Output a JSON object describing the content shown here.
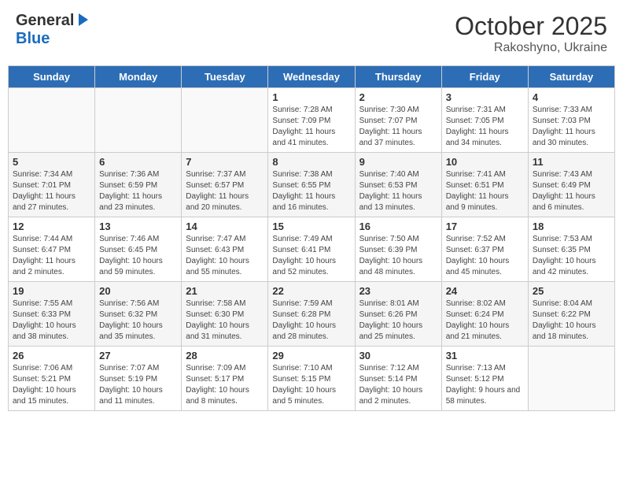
{
  "header": {
    "logo_general": "General",
    "logo_blue": "Blue",
    "month": "October 2025",
    "location": "Rakoshyno, Ukraine"
  },
  "days_of_week": [
    "Sunday",
    "Monday",
    "Tuesday",
    "Wednesday",
    "Thursday",
    "Friday",
    "Saturday"
  ],
  "weeks": [
    [
      {
        "day": "",
        "info": ""
      },
      {
        "day": "",
        "info": ""
      },
      {
        "day": "",
        "info": ""
      },
      {
        "day": "1",
        "info": "Sunrise: 7:28 AM\nSunset: 7:09 PM\nDaylight: 11 hours\nand 41 minutes."
      },
      {
        "day": "2",
        "info": "Sunrise: 7:30 AM\nSunset: 7:07 PM\nDaylight: 11 hours\nand 37 minutes."
      },
      {
        "day": "3",
        "info": "Sunrise: 7:31 AM\nSunset: 7:05 PM\nDaylight: 11 hours\nand 34 minutes."
      },
      {
        "day": "4",
        "info": "Sunrise: 7:33 AM\nSunset: 7:03 PM\nDaylight: 11 hours\nand 30 minutes."
      }
    ],
    [
      {
        "day": "5",
        "info": "Sunrise: 7:34 AM\nSunset: 7:01 PM\nDaylight: 11 hours\nand 27 minutes."
      },
      {
        "day": "6",
        "info": "Sunrise: 7:36 AM\nSunset: 6:59 PM\nDaylight: 11 hours\nand 23 minutes."
      },
      {
        "day": "7",
        "info": "Sunrise: 7:37 AM\nSunset: 6:57 PM\nDaylight: 11 hours\nand 20 minutes."
      },
      {
        "day": "8",
        "info": "Sunrise: 7:38 AM\nSunset: 6:55 PM\nDaylight: 11 hours\nand 16 minutes."
      },
      {
        "day": "9",
        "info": "Sunrise: 7:40 AM\nSunset: 6:53 PM\nDaylight: 11 hours\nand 13 minutes."
      },
      {
        "day": "10",
        "info": "Sunrise: 7:41 AM\nSunset: 6:51 PM\nDaylight: 11 hours\nand 9 minutes."
      },
      {
        "day": "11",
        "info": "Sunrise: 7:43 AM\nSunset: 6:49 PM\nDaylight: 11 hours\nand 6 minutes."
      }
    ],
    [
      {
        "day": "12",
        "info": "Sunrise: 7:44 AM\nSunset: 6:47 PM\nDaylight: 11 hours\nand 2 minutes."
      },
      {
        "day": "13",
        "info": "Sunrise: 7:46 AM\nSunset: 6:45 PM\nDaylight: 10 hours\nand 59 minutes."
      },
      {
        "day": "14",
        "info": "Sunrise: 7:47 AM\nSunset: 6:43 PM\nDaylight: 10 hours\nand 55 minutes."
      },
      {
        "day": "15",
        "info": "Sunrise: 7:49 AM\nSunset: 6:41 PM\nDaylight: 10 hours\nand 52 minutes."
      },
      {
        "day": "16",
        "info": "Sunrise: 7:50 AM\nSunset: 6:39 PM\nDaylight: 10 hours\nand 48 minutes."
      },
      {
        "day": "17",
        "info": "Sunrise: 7:52 AM\nSunset: 6:37 PM\nDaylight: 10 hours\nand 45 minutes."
      },
      {
        "day": "18",
        "info": "Sunrise: 7:53 AM\nSunset: 6:35 PM\nDaylight: 10 hours\nand 42 minutes."
      }
    ],
    [
      {
        "day": "19",
        "info": "Sunrise: 7:55 AM\nSunset: 6:33 PM\nDaylight: 10 hours\nand 38 minutes."
      },
      {
        "day": "20",
        "info": "Sunrise: 7:56 AM\nSunset: 6:32 PM\nDaylight: 10 hours\nand 35 minutes."
      },
      {
        "day": "21",
        "info": "Sunrise: 7:58 AM\nSunset: 6:30 PM\nDaylight: 10 hours\nand 31 minutes."
      },
      {
        "day": "22",
        "info": "Sunrise: 7:59 AM\nSunset: 6:28 PM\nDaylight: 10 hours\nand 28 minutes."
      },
      {
        "day": "23",
        "info": "Sunrise: 8:01 AM\nSunset: 6:26 PM\nDaylight: 10 hours\nand 25 minutes."
      },
      {
        "day": "24",
        "info": "Sunrise: 8:02 AM\nSunset: 6:24 PM\nDaylight: 10 hours\nand 21 minutes."
      },
      {
        "day": "25",
        "info": "Sunrise: 8:04 AM\nSunset: 6:22 PM\nDaylight: 10 hours\nand 18 minutes."
      }
    ],
    [
      {
        "day": "26",
        "info": "Sunrise: 7:06 AM\nSunset: 5:21 PM\nDaylight: 10 hours\nand 15 minutes."
      },
      {
        "day": "27",
        "info": "Sunrise: 7:07 AM\nSunset: 5:19 PM\nDaylight: 10 hours\nand 11 minutes."
      },
      {
        "day": "28",
        "info": "Sunrise: 7:09 AM\nSunset: 5:17 PM\nDaylight: 10 hours\nand 8 minutes."
      },
      {
        "day": "29",
        "info": "Sunrise: 7:10 AM\nSunset: 5:15 PM\nDaylight: 10 hours\nand 5 minutes."
      },
      {
        "day": "30",
        "info": "Sunrise: 7:12 AM\nSunset: 5:14 PM\nDaylight: 10 hours\nand 2 minutes."
      },
      {
        "day": "31",
        "info": "Sunrise: 7:13 AM\nSunset: 5:12 PM\nDaylight: 9 hours\nand 58 minutes."
      },
      {
        "day": "",
        "info": ""
      }
    ]
  ]
}
